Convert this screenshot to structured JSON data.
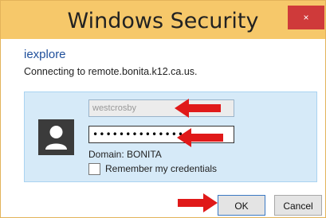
{
  "window": {
    "title": "Windows Security",
    "close_symbol": "×"
  },
  "dialog": {
    "app_name": "iexplore",
    "connecting_text": "Connecting to remote.bonita.k12.ca.us."
  },
  "credentials": {
    "username_value": "westcrosby",
    "password_value": "••••••••••••••",
    "domain_text": "Domain: BONITA",
    "remember_label": "Remember my credentials"
  },
  "buttons": {
    "ok_label": "OK",
    "cancel_label": "Cancel"
  },
  "colors": {
    "titlebar": "#f6c86a",
    "close_button": "#cf3a3a",
    "credential_panel": "#d6eaf8",
    "annotation_arrow": "#e01919"
  },
  "icons": {
    "avatar": "user-avatar-icon",
    "close": "close-icon",
    "arrow": "arrow-left-icon",
    "arrow_ok": "arrow-right-icon"
  }
}
